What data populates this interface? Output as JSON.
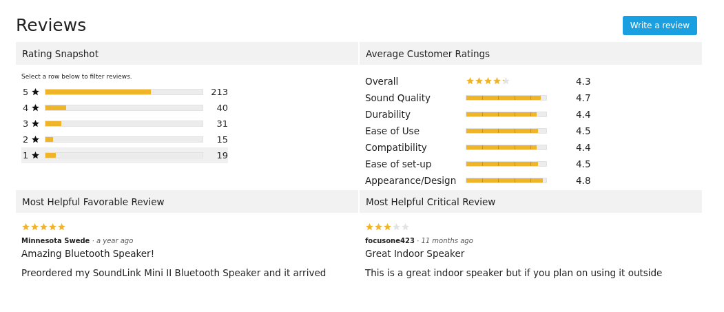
{
  "title": "Reviews",
  "write_button": "Write a review",
  "rating_snapshot": {
    "heading": "Rating Snapshot",
    "hint": "Select a row below to filter reviews.",
    "rows": [
      {
        "label": "5",
        "level": 0.67,
        "count": "213",
        "highlighted": false
      },
      {
        "label": "4",
        "level": 0.13,
        "count": "40",
        "highlighted": false
      },
      {
        "label": "3",
        "level": 0.1,
        "count": "31",
        "highlighted": false
      },
      {
        "label": "2",
        "level": 0.05,
        "count": "15",
        "highlighted": false
      },
      {
        "label": "1",
        "level": 0.065,
        "count": "19",
        "highlighted": true
      }
    ]
  },
  "average_ratings": {
    "heading": "Average Customer Ratings",
    "rows": [
      {
        "kind": "stars",
        "label": "Overall",
        "stars": 4.3,
        "value": "4.3"
      },
      {
        "kind": "bar",
        "label": "Sound Quality",
        "level": 0.93,
        "value": "4.7"
      },
      {
        "kind": "bar",
        "label": "Durability",
        "level": 0.88,
        "value": "4.4"
      },
      {
        "kind": "bar",
        "label": "Ease of Use",
        "level": 0.9,
        "value": "4.5"
      },
      {
        "kind": "bar",
        "label": "Compatibility",
        "level": 0.88,
        "value": "4.4"
      },
      {
        "kind": "bar",
        "label": "Ease of set-up",
        "level": 0.9,
        "value": "4.5"
      },
      {
        "kind": "bar",
        "label": "Appearance/Design",
        "level": 0.96,
        "value": "4.8"
      }
    ]
  },
  "reviews": [
    {
      "heading": "Most Helpful Favorable Review",
      "stars": 5,
      "author": "Minnesota Swede",
      "time": "· a year ago",
      "title": "Amazing Bluetooth Speaker!",
      "body": "Preordered my SoundLink Mini II Bluetooth Speaker and it arrived"
    },
    {
      "heading": "Most Helpful Critical Review",
      "stars": 3,
      "author": "focusone423",
      "time": "· 11 months ago",
      "title": "Great Indoor Speaker",
      "body": "This is a great indoor speaker but if you plan on using it outside"
    }
  ]
}
